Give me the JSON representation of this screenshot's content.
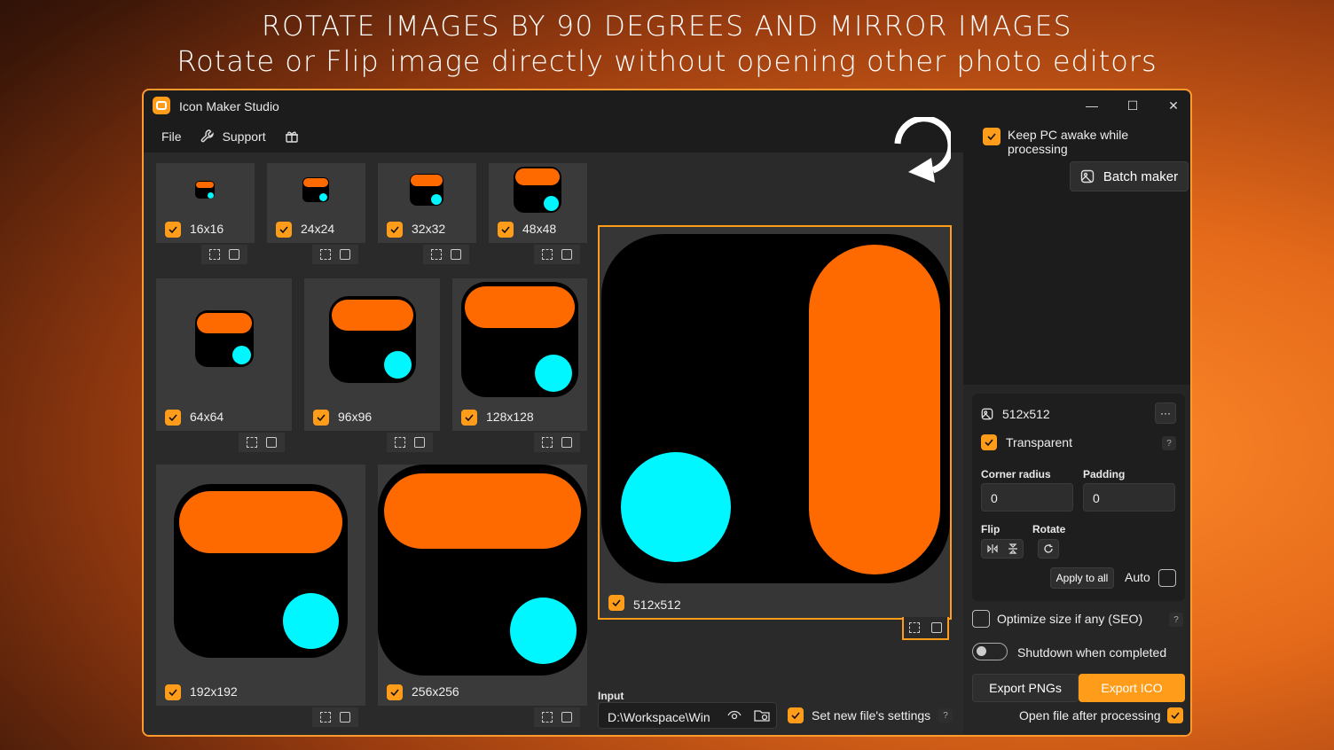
{
  "headline": {
    "line1": "ROTATE IMAGES BY 90 DEGREES AND MIRROR IMAGES",
    "line2": "Rotate or Flip image directly without opening other photo editors"
  },
  "window": {
    "title": "Icon Maker Studio",
    "minimize": "—",
    "maximize": "☐",
    "close": "✕"
  },
  "menu": {
    "file": "File",
    "support": "Support"
  },
  "keep_awake": {
    "label": "Keep PC awake while processing",
    "checked": true
  },
  "batch_maker": "Batch maker",
  "sizes": [
    "16x16",
    "24x24",
    "32x32",
    "48x48",
    "64x64",
    "96x96",
    "128x128",
    "192x192",
    "256x256"
  ],
  "preview": {
    "label": "512x512"
  },
  "settings": {
    "size_label": "512x512",
    "more": "···",
    "transparent": "Transparent",
    "help": "?",
    "corner_radius_label": "Corner radius",
    "corner_radius": "0",
    "padding_label": "Padding",
    "padding": "0",
    "flip_label": "Flip",
    "rotate_label": "Rotate",
    "apply_all": "Apply to all",
    "auto": "Auto"
  },
  "optimize": "Optimize size if any (SEO)",
  "shutdown": "Shutdown when completed",
  "export": {
    "pngs": "Export PNGs",
    "ico": "Export ICO"
  },
  "open_after": "Open file after processing",
  "input": {
    "label": "Input",
    "value": "D:\\Workspace\\Win"
  },
  "new_file_settings": "Set new file's settings",
  "colors": {
    "accent": "#ff9d1a",
    "bar": "#ff6a00",
    "dot": "#00f7ff"
  }
}
